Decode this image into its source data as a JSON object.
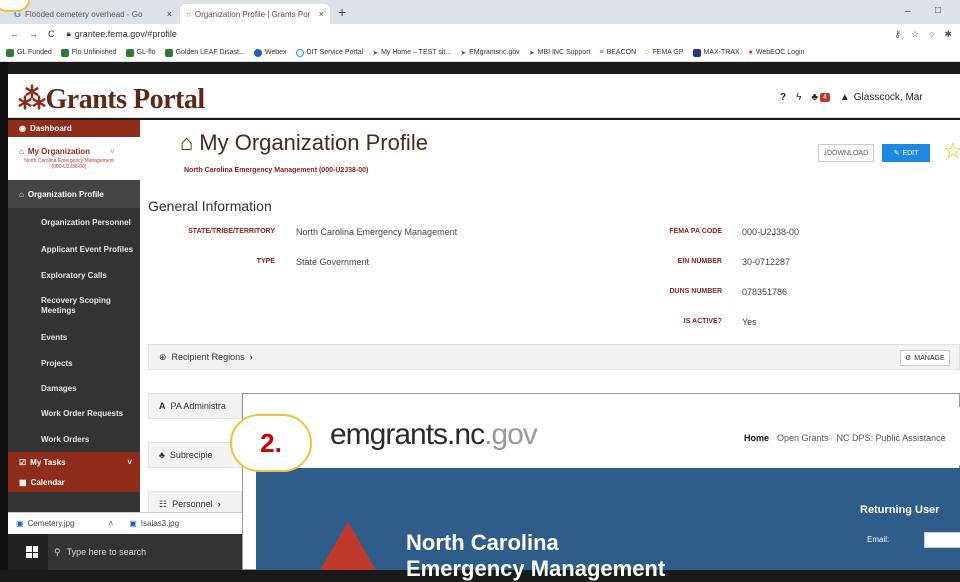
{
  "browser": {
    "tabs": [
      {
        "label": "Flooded cemetery overhead - Go"
      },
      {
        "label": "Organization Profile | Grants Por"
      }
    ],
    "url": "grantee.fema.gov/#profile",
    "bookmarks": [
      "GL Funded",
      "Flo Unfinished",
      "GL-flo",
      "Golden LEAF Disast...",
      "Webex",
      "DIT Service Portal",
      "My Home – TEST sit...",
      "EMgrantsnc.gov",
      "MBI INC Support",
      "BEACON",
      "FEMA GP",
      "MAX-TRAX",
      "WebEOC Login"
    ]
  },
  "portal": {
    "logo": "Grants Portal",
    "notifications": "4",
    "user": "Glasscock, Mar"
  },
  "sidebar": {
    "items": [
      {
        "label": "Dashboard"
      },
      {
        "label": "My Organization",
        "sub": "North Carolina Emergency Management (000-U2J38-00)"
      },
      {
        "label": "Organization Profile"
      },
      {
        "label": "Organization Personnel"
      },
      {
        "label": "Applicant Event Profiles"
      },
      {
        "label": "Exploratory Calls"
      },
      {
        "label": "Recovery Scoping Meetings"
      },
      {
        "label": "Events"
      },
      {
        "label": "Projects"
      },
      {
        "label": "Damages"
      },
      {
        "label": "Work Order Requests"
      },
      {
        "label": "Work Orders"
      },
      {
        "label": "My Tasks"
      },
      {
        "label": "Calendar"
      }
    ]
  },
  "profile": {
    "title": "My Organization Profile",
    "org": "North Carolina Emergency Management (000-U2J38-00)",
    "download": "DOWNLOAD",
    "edit": "EDIT",
    "general_header": "General Information",
    "fields": {
      "state_label": "STATE/TRIBE/TERRITORY",
      "state": "North Carolina Emergency Management",
      "type_label": "TYPE",
      "type": "State Government",
      "pacode_label": "FEMA PA CODE",
      "pacode": "000-U2J38-00",
      "ein_label": "EIN NUMBER",
      "ein": "30-0712287",
      "duns_label": "DUNS NUMBER",
      "duns": "078351786",
      "active_label": "IS ACTIVE?",
      "active": "Yes"
    },
    "panels": [
      "Recipient Regions",
      "PA Administra",
      "Subrecipie",
      "Personnel"
    ],
    "manage": "MANAGE"
  },
  "taskbar": {
    "downloads": [
      "Cemetery.jpg",
      "Isaias3.jpg"
    ],
    "search": "Type here to search"
  },
  "overlay": {
    "badge": "2.",
    "logo": "emgrants.nc",
    "logo_gov": ".gov",
    "nav": [
      "Home",
      "Open Grants",
      "NC DPS: Public Assistance"
    ],
    "heading": "North Carolina",
    "heading2": "Emergency Management",
    "returning": "Returning User",
    "email_label": "Email:"
  },
  "colors": {
    "brand": "#8f2d1a",
    "sidebar": "#333333",
    "edit": "#1e88e5",
    "banner": "#2f5d8a"
  }
}
